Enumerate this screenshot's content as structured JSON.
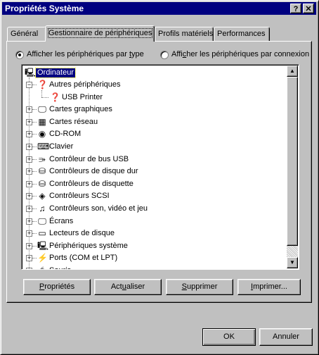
{
  "window": {
    "title": "Propriétés Système",
    "help_label": "?",
    "close_label": "✕"
  },
  "tabs": [
    {
      "label": "Général"
    },
    {
      "label": "Gestionnaire de périphériques"
    },
    {
      "label": "Profils matériels"
    },
    {
      "label": "Performances"
    }
  ],
  "view_options": {
    "by_type": {
      "pre": "Afficher les périphériques par ",
      "key": "t",
      "post": "ype",
      "selected": true
    },
    "by_connection": {
      "pre": "Affi",
      "key": "c",
      "post": "her les périphériques par connexion",
      "selected": false
    }
  },
  "tree": {
    "root": "Ordinateur",
    "items": [
      {
        "label": "Autres périphériques",
        "icon": "question-device-icon",
        "expanded": true
      },
      {
        "label": "USB Printer",
        "icon": "question-device-icon",
        "child": true
      },
      {
        "label": "Cartes graphiques",
        "icon": "monitor-icon"
      },
      {
        "label": "Cartes réseau",
        "icon": "network-card-icon"
      },
      {
        "label": "CD-ROM",
        "icon": "cdrom-icon"
      },
      {
        "label": "Clavier",
        "icon": "keyboard-icon"
      },
      {
        "label": "Contrôleur de bus USB",
        "icon": "usb-icon"
      },
      {
        "label": "Contrôleurs de disque dur",
        "icon": "harddisk-icon"
      },
      {
        "label": "Contrôleurs de disquette",
        "icon": "floppy-controller-icon"
      },
      {
        "label": "Contrôleurs SCSI",
        "icon": "scsi-icon"
      },
      {
        "label": "Contrôleurs son, vidéo et jeu",
        "icon": "sound-icon"
      },
      {
        "label": "Écrans",
        "icon": "monitor-icon"
      },
      {
        "label": "Lecteurs de disque",
        "icon": "disk-drive-icon"
      },
      {
        "label": "Périphériques système",
        "icon": "computer-icon"
      },
      {
        "label": "Ports (COM et LPT)",
        "icon": "port-icon"
      },
      {
        "label": "Souris",
        "icon": "mouse-icon"
      }
    ]
  },
  "buttons": {
    "properties": {
      "key": "P",
      "rest": "ropriétés"
    },
    "refresh": {
      "pre": "Act",
      "key": "u",
      "post": "aliser"
    },
    "remove": {
      "key": "S",
      "rest": "upprimer"
    },
    "print": {
      "key": "I",
      "rest": "mprimer..."
    },
    "ok": "OK",
    "cancel": "Annuler"
  }
}
